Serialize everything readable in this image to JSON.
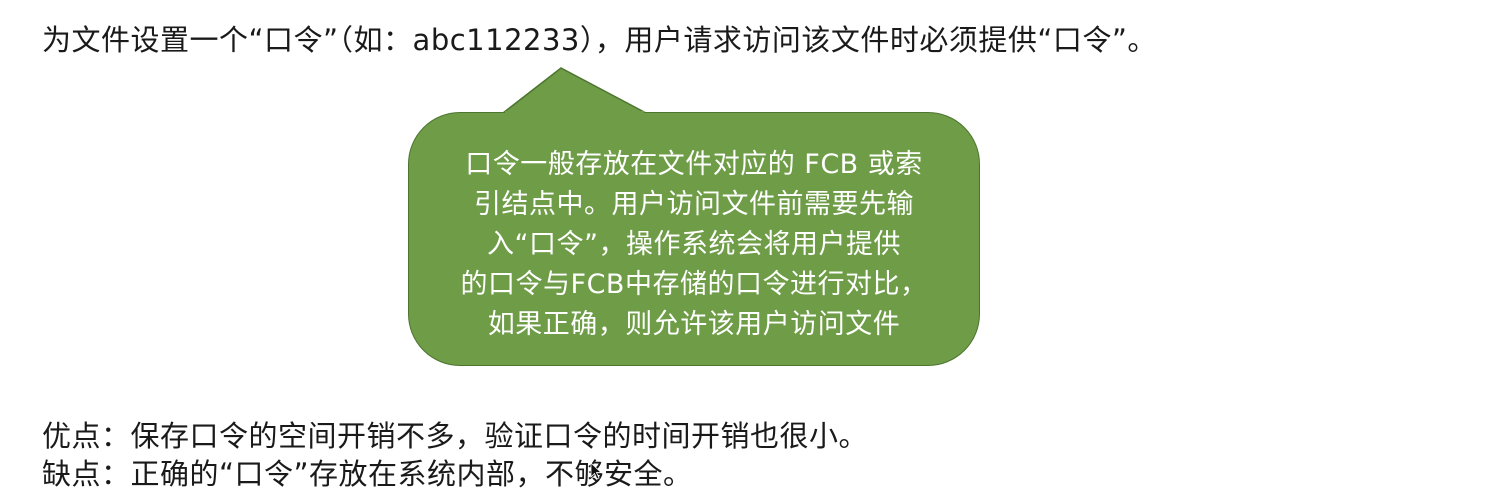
{
  "intro_text": "为文件设置一个“口令”（如：abc112233），用户请求访问该文件时必须提供“口令”。",
  "callout": {
    "lines": [
      "口令一般存放在文件对应的 FCB 或索",
      "引结点中。用户访问文件前需要先输",
      "入“口令”，操作系统会将用户提供",
      "的口令与FCB中存储的口令进行对比，",
      "如果正确，则允许该用户访问文件"
    ],
    "fill_color": "#6e9c47"
  },
  "advantage_text": "优点：保存口令的空间开销不多，验证口令的时间开销也很小。",
  "disadvantage_text": "缺点：正确的“口令”存放在系统内部，不够安全。",
  "cursor_icon": "mouse-pointer-icon"
}
